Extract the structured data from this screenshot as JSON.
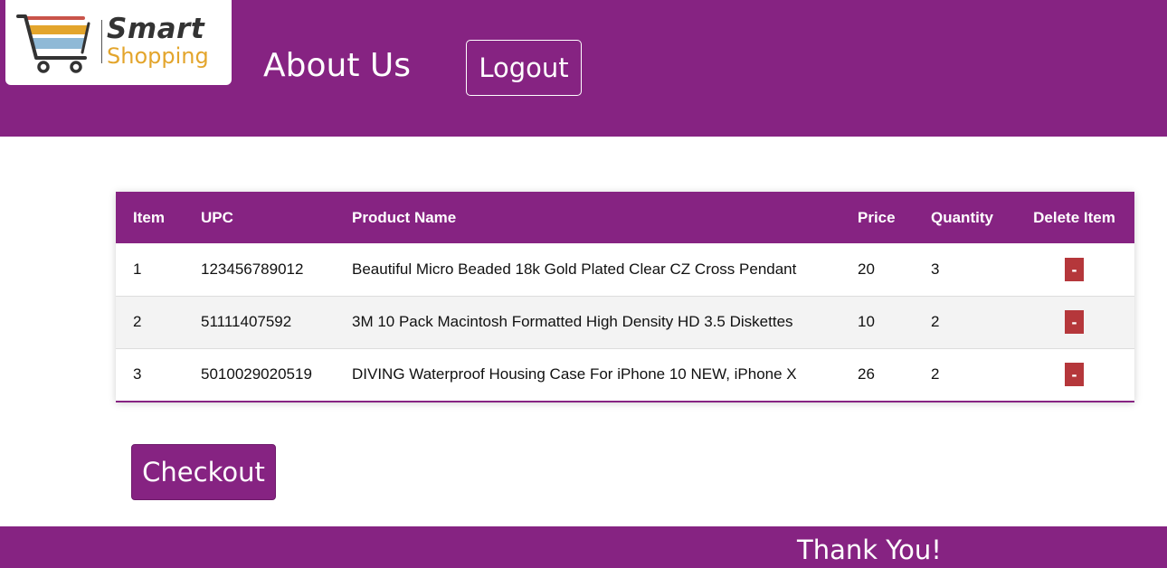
{
  "brand": {
    "name_line1": "Smart",
    "name_line2": "Shopping",
    "colors": {
      "primary": "#862382",
      "logo_dark": "#333333",
      "logo_accent": "#e3a52c",
      "delete": "#b5373b"
    }
  },
  "header": {
    "about_label": "About Us",
    "logout_label": "Logout"
  },
  "cart_table": {
    "columns": [
      "Item",
      "UPC",
      "Product Name",
      "Price",
      "Quantity",
      "Delete Item"
    ],
    "rows": [
      {
        "item": "1",
        "upc": "123456789012",
        "product_name": "Beautiful Micro Beaded 18k Gold Plated Clear CZ Cross Pendant",
        "price": "20",
        "quantity": "3",
        "delete_label": "-"
      },
      {
        "item": "2",
        "upc": "51111407592",
        "product_name": "3M 10 Pack Macintosh Formatted High Density HD 3.5 Diskettes",
        "price": "10",
        "quantity": "2",
        "delete_label": "-"
      },
      {
        "item": "3",
        "upc": "5010029020519",
        "product_name": "DIVING Waterproof Housing Case For iPhone 10 NEW, iPhone X",
        "price": "26",
        "quantity": "2",
        "delete_label": "-"
      }
    ]
  },
  "checkout_label": "Checkout",
  "footer": {
    "text": "Thank You!"
  }
}
